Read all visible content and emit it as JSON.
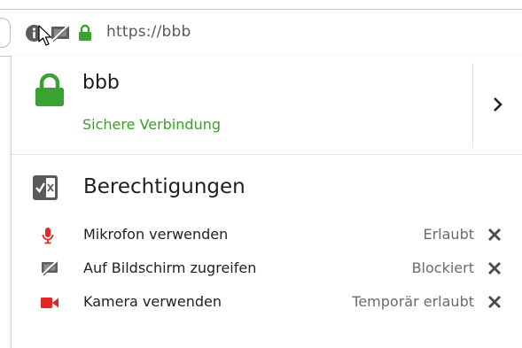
{
  "urlbar": {
    "url": "https://bbb",
    "icons": [
      "info-icon",
      "screen-blocked-icon",
      "lock-icon"
    ]
  },
  "identity": {
    "host": "bbb",
    "connection": "Sichere Verbindung",
    "icons": [
      "lock-icon",
      "chevron-right-icon"
    ]
  },
  "permissions": {
    "title": "Berechtigungen",
    "items": [
      {
        "label": "Mikrofon verwenden",
        "state": "Erlaubt",
        "icon": "microphone-icon"
      },
      {
        "label": "Auf Bildschirm zugreifen",
        "state": "Blockiert",
        "icon": "screen-share-blocked-icon"
      },
      {
        "label": "Kamera verwenden",
        "state": "Temporär erlaubt",
        "icon": "camera-icon"
      }
    ]
  },
  "colors": {
    "secure_green": "#3e9d2e",
    "lock_green": "#3aa133",
    "media_red": "#e0282a"
  }
}
